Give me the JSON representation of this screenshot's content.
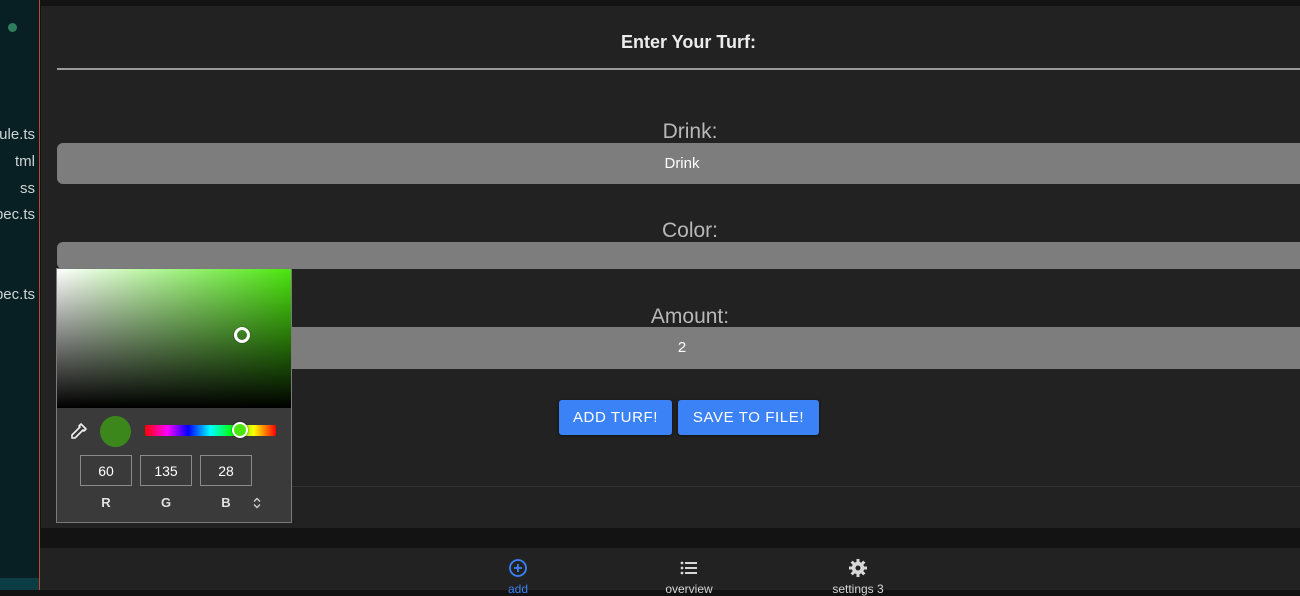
{
  "sidebar": {
    "files": [
      "ule.ts",
      "tml",
      "ss",
      "pec.ts",
      "pec.ts"
    ]
  },
  "form": {
    "title": "Enter Your Turf:",
    "drink_label": "Drink:",
    "drink_placeholder": "Drink",
    "color_label": "Color:",
    "amount_label": "Amount:",
    "amount_value": "2",
    "add_button": "ADD TURF!",
    "save_button": "SAVE TO FILE!"
  },
  "color_picker": {
    "selected_color": "#3c871c",
    "hue_color": "#4be60d",
    "r": "60",
    "g": "135",
    "b": "28",
    "r_label": "R",
    "g_label": "G",
    "b_label": "B"
  },
  "nav": {
    "items": [
      {
        "label": "add",
        "icon": "plus-circle-icon",
        "active": true
      },
      {
        "label": "overview",
        "icon": "list-icon",
        "active": false
      },
      {
        "label": "settings 3",
        "icon": "gear-icon",
        "active": false
      }
    ]
  },
  "colors": {
    "accent": "#3b82f6",
    "panel": "#222222",
    "input": "#7d7d7d"
  }
}
